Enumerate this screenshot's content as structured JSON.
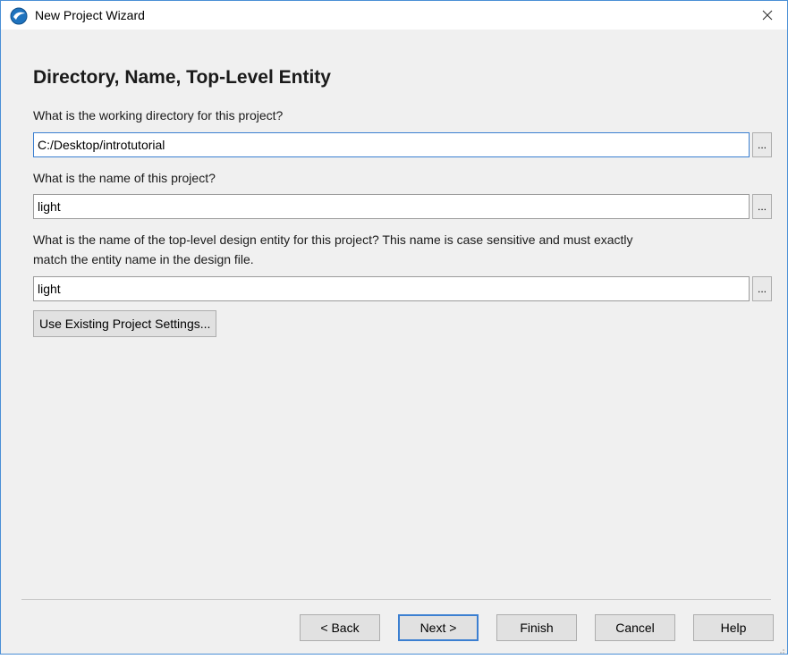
{
  "window": {
    "title": "New Project Wizard",
    "icon": "quartus-app-icon",
    "close_icon": "close-icon"
  },
  "page": {
    "heading": "Directory, Name, Top-Level Entity",
    "working_dir": {
      "label": "What is the working directory for this project?",
      "value": "C:/Desktop/introtutorial",
      "browse_label": "..."
    },
    "project_name": {
      "label": "What is the name of this project?",
      "value": "light",
      "browse_label": "..."
    },
    "top_level": {
      "label_line1": "What is the name of the top-level design entity for this project? This name is case sensitive and must exactly",
      "label_line2": "match the entity name in the design file.",
      "value": "light",
      "browse_label": "..."
    },
    "existing_settings_label": "Use Existing Project Settings..."
  },
  "footer": {
    "back_label": "< Back",
    "next_label": "Next >",
    "finish_label": "Finish",
    "cancel_label": "Cancel",
    "help_label": "Help"
  },
  "colors": {
    "accent": "#3b7fd1",
    "dialog_bg": "#f0f0f0",
    "button_bg": "#e1e1e1"
  }
}
